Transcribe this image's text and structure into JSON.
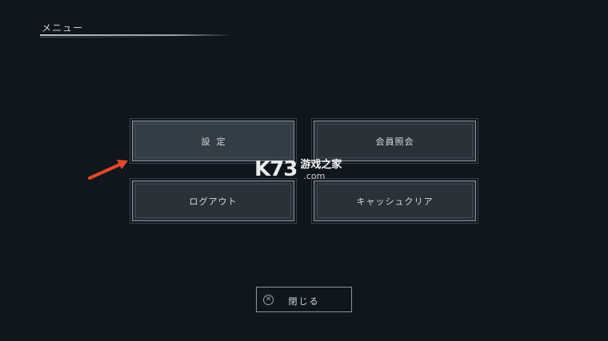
{
  "header": {
    "title": "メニュー"
  },
  "menu": {
    "settings_label": "設定",
    "member_label": "会員照会",
    "logout_label": "ログアウト",
    "cache_label": "キャッシュクリア"
  },
  "close": {
    "label": "閉じる",
    "icon": "close-circle-icon"
  },
  "watermark": {
    "logo": "K73",
    "text": "游戏之家",
    "domain": ".com"
  },
  "colors": {
    "background": "#10161b",
    "button": "#2a3238",
    "arrow": "#e0492b",
    "text": "#d6dbde"
  }
}
